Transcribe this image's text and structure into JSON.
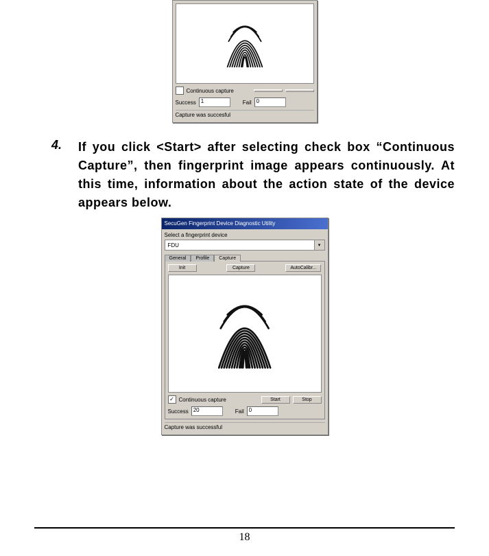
{
  "page_number": "18",
  "step": {
    "number": "4.",
    "text": "If you click <Start> after selecting check box “Continuous Capture”, then fingerprint image appears continuously. At this time, information about the action state of the device appears below."
  },
  "dialog1": {
    "continuous_capture_label": "Continuous capture",
    "continuous_checked": "",
    "btn_a": "",
    "btn_b": "",
    "success_label": "Success",
    "success_value": "1",
    "fail_label": "Fail",
    "fail_value": "0",
    "status": "Capture was  succesful"
  },
  "dialog2": {
    "title": "SecuGen Fingerprint Device Diagnostic Utility",
    "select_label": "Select a fingerprint device",
    "select_value": "FDU",
    "tab1": "General",
    "tab2": "Profile",
    "tab3": "Capture",
    "btn_init": "Init",
    "btn_capture": "Capture",
    "btn_calib": "AutoCalibr...",
    "continuous_capture_label": "Continuous capture",
    "continuous_checked": "✓",
    "btn_start": "Start",
    "btn_stop": "Stop",
    "success_label": "Success",
    "success_value": "20",
    "fail_label": "Fail",
    "fail_value": "0",
    "status": "Capture was  successful"
  }
}
